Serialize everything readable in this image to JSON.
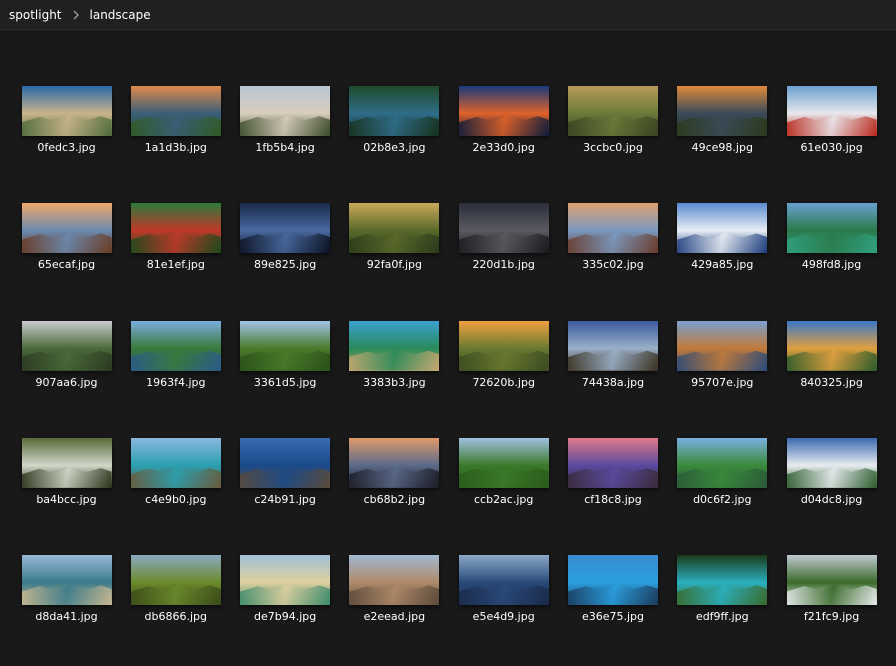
{
  "breadcrumb": {
    "items": [
      "spotlight",
      "landscape"
    ]
  },
  "files": [
    {
      "name": "0fedc3.jpg",
      "colors": [
        "#2a6aa8",
        "#c9b48a",
        "#4d6a3a"
      ]
    },
    {
      "name": "1a1d3b.jpg",
      "colors": [
        "#e08a4a",
        "#3a5e7a",
        "#2f5a22"
      ]
    },
    {
      "name": "1fb5b4.jpg",
      "colors": [
        "#b8c7d4",
        "#d7cdbc",
        "#3a4a2a"
      ]
    },
    {
      "name": "02b8e3.jpg",
      "colors": [
        "#1e4a2a",
        "#2f6d8a",
        "#16301a"
      ]
    },
    {
      "name": "2e33d0.jpg",
      "colors": [
        "#1a3a7a",
        "#e0622a",
        "#0a1a3a"
      ]
    },
    {
      "name": "3ccbc0.jpg",
      "colors": [
        "#b99a5a",
        "#6a7a3a",
        "#3a4220"
      ]
    },
    {
      "name": "49ce98.jpg",
      "colors": [
        "#e08a3a",
        "#3a4a5a",
        "#2a3a1a"
      ]
    },
    {
      "name": "61e030.jpg",
      "colors": [
        "#6aa0d0",
        "#e8e8ec",
        "#b8261a"
      ]
    },
    {
      "name": "65ecaf.jpg",
      "colors": [
        "#f0a86a",
        "#6a8ab0",
        "#6a3a22"
      ]
    },
    {
      "name": "81e1ef.jpg",
      "colors": [
        "#2a7a3a",
        "#c0382a",
        "#1a4a1a"
      ]
    },
    {
      "name": "89e825.jpg",
      "colors": [
        "#1a2a4a",
        "#4a6aa0",
        "#0a1020"
      ]
    },
    {
      "name": "92fa0f.jpg",
      "colors": [
        "#c8a85a",
        "#5a6a2a",
        "#2a3a1a"
      ]
    },
    {
      "name": "220d1b.jpg",
      "colors": [
        "#2a2e3a",
        "#5a5a60",
        "#1a1a1e"
      ]
    },
    {
      "name": "335c02.jpg",
      "colors": [
        "#e0a070",
        "#7a9ac0",
        "#6a3a2a"
      ]
    },
    {
      "name": "429a85.jpg",
      "colors": [
        "#5a8ad0",
        "#e8eef4",
        "#1a3a7a"
      ]
    },
    {
      "name": "498fd8.jpg",
      "colors": [
        "#6aa0d0",
        "#2a7a4a",
        "#30a080"
      ]
    },
    {
      "name": "907aa6.jpg",
      "colors": [
        "#c8ccd0",
        "#4a6a3a",
        "#2a3a22"
      ]
    },
    {
      "name": "1963f4.jpg",
      "colors": [
        "#7aaee0",
        "#3a7a3a",
        "#2a5a8a"
      ]
    },
    {
      "name": "3361d5.jpg",
      "colors": [
        "#a0c4e8",
        "#4a7a2a",
        "#2a5018"
      ]
    },
    {
      "name": "3383b3.jpg",
      "colors": [
        "#3aa0d0",
        "#2a8a5a",
        "#c8a870"
      ]
    },
    {
      "name": "72620b.jpg",
      "colors": [
        "#f0a040",
        "#6a7a30",
        "#3a4a20"
      ]
    },
    {
      "name": "74438a.jpg",
      "colors": [
        "#3a5aa0",
        "#9ab0c8",
        "#3a3020"
      ]
    },
    {
      "name": "95707e.jpg",
      "colors": [
        "#7aa0d0",
        "#c07a3a",
        "#2a4a7a"
      ]
    },
    {
      "name": "840325.jpg",
      "colors": [
        "#3a78c8",
        "#e0a040",
        "#2a5a2a"
      ]
    },
    {
      "name": "ba4bcc.jpg",
      "colors": [
        "#5a6a3a",
        "#d0d8c8",
        "#2a3018"
      ]
    },
    {
      "name": "c4e9b0.jpg",
      "colors": [
        "#8ab8e0",
        "#2aa0b0",
        "#6a5a3a"
      ]
    },
    {
      "name": "c24b91.jpg",
      "colors": [
        "#3a6ab0",
        "#1a4a8a",
        "#5a4a3a"
      ]
    },
    {
      "name": "cb68b2.jpg",
      "colors": [
        "#e09a6a",
        "#5a6a8a",
        "#1a1a22"
      ]
    },
    {
      "name": "ccb2ac.jpg",
      "colors": [
        "#a0c0e0",
        "#3a7a2a",
        "#2a5a1a"
      ]
    },
    {
      "name": "cf18c8.jpg",
      "colors": [
        "#e07a8a",
        "#5a4aa0",
        "#3a2a3a"
      ]
    },
    {
      "name": "d0c6f2.jpg",
      "colors": [
        "#7ab0e0",
        "#3a8a3a",
        "#2a5a3a"
      ]
    },
    {
      "name": "d04dc8.jpg",
      "colors": [
        "#3a6ab0",
        "#e8ecf0",
        "#2a5a2a"
      ]
    },
    {
      "name": "d8da41.jpg",
      "colors": [
        "#9ab8d8",
        "#3a7a8a",
        "#c8b890"
      ]
    },
    {
      "name": "db6866.jpg",
      "colors": [
        "#8aa8c0",
        "#6a8a2a",
        "#3a4a1a"
      ]
    },
    {
      "name": "de7b94.jpg",
      "colors": [
        "#a0c0d8",
        "#e0d0a0",
        "#3a8a6a"
      ]
    },
    {
      "name": "e2eead.jpg",
      "colors": [
        "#a0b8d0",
        "#b08a6a",
        "#5a4a3a"
      ]
    },
    {
      "name": "e5e4d9.jpg",
      "colors": [
        "#8aa8c8",
        "#2a4a7a",
        "#1a2a4a"
      ]
    },
    {
      "name": "e36e75.jpg",
      "colors": [
        "#3a8ad0",
        "#2aa0e0",
        "#1a3a5a"
      ]
    },
    {
      "name": "edf9ff.jpg",
      "colors": [
        "#1a3a1a",
        "#2ab0c0",
        "#3a6a2a"
      ]
    },
    {
      "name": "f21fc9.jpg",
      "colors": [
        "#c0c8d0",
        "#3a6a2a",
        "#e8ecee"
      ]
    }
  ]
}
